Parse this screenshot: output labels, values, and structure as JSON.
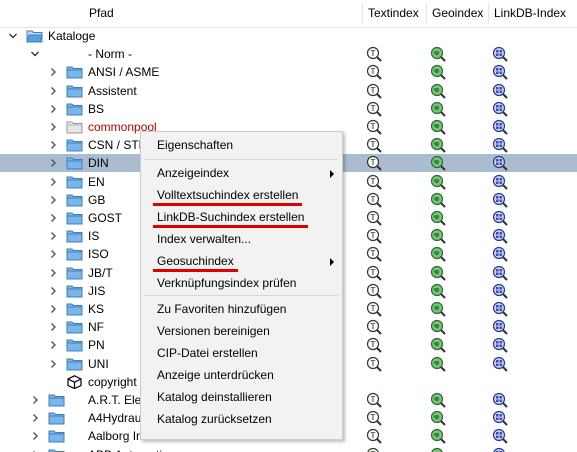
{
  "columns": {
    "path": "Pfad",
    "text": "Textindex",
    "geo": "Geoindex",
    "linkdb": "LinkDB-Index"
  },
  "tree": [
    {
      "label": "Kataloge",
      "kind": "root",
      "expander": "expanded",
      "icons": false
    },
    {
      "label": "- Norm -",
      "kind": "none",
      "expander": "expanded",
      "icons": true
    },
    {
      "label": "ANSI / ASME",
      "kind": "folder",
      "expander": "collapsed",
      "icons": true
    },
    {
      "label": "Assistent",
      "kind": "folder",
      "expander": "collapsed",
      "icons": true
    },
    {
      "label": "BS",
      "kind": "folder",
      "expander": "collapsed",
      "icons": true
    },
    {
      "label": "commonpool",
      "kind": "folder-gray",
      "expander": "collapsed",
      "icons": true,
      "red": true
    },
    {
      "label": "CSN / STN",
      "kind": "folder",
      "expander": "collapsed",
      "icons": true
    },
    {
      "label": "DIN",
      "kind": "folder",
      "expander": "collapsed",
      "icons": true,
      "selected": true
    },
    {
      "label": "EN",
      "kind": "folder",
      "expander": "collapsed",
      "icons": true
    },
    {
      "label": "GB",
      "kind": "folder",
      "expander": "collapsed",
      "icons": true
    },
    {
      "label": "GOST",
      "kind": "folder",
      "expander": "collapsed",
      "icons": true
    },
    {
      "label": "IS",
      "kind": "folder",
      "expander": "collapsed",
      "icons": true
    },
    {
      "label": "ISO",
      "kind": "folder",
      "expander": "collapsed",
      "icons": true
    },
    {
      "label": "JB/T",
      "kind": "folder",
      "expander": "collapsed",
      "icons": true
    },
    {
      "label": "JIS",
      "kind": "folder",
      "expander": "collapsed",
      "icons": true
    },
    {
      "label": "KS",
      "kind": "folder",
      "expander": "collapsed",
      "icons": true
    },
    {
      "label": "NF",
      "kind": "folder",
      "expander": "collapsed",
      "icons": true
    },
    {
      "label": "PN",
      "kind": "folder",
      "expander": "collapsed",
      "icons": true
    },
    {
      "label": "UNI",
      "kind": "folder",
      "expander": "collapsed",
      "icons": true
    },
    {
      "label": "copyright",
      "kind": "cube",
      "expander": "none",
      "icons": false
    },
    {
      "label": "A.R.T. Elek",
      "kind": "folder",
      "expander": "collapsed",
      "icons": true,
      "level": 1
    },
    {
      "label": "A4Hydrau",
      "kind": "folder",
      "expander": "collapsed",
      "icons": true,
      "level": 1
    },
    {
      "label": "Aalborg In",
      "kind": "folder",
      "expander": "collapsed",
      "icons": true,
      "level": 1
    },
    {
      "label": "ABB Automation",
      "kind": "folder",
      "expander": "collapsed",
      "icons": true,
      "level": 1
    }
  ],
  "context_menu": {
    "items": [
      {
        "label": "Eigenschaften"
      },
      {
        "sep": true
      },
      {
        "label": "Anzeigeindex",
        "submenu": true
      },
      {
        "label": "Volltextsuchindex erstellen",
        "underline": true
      },
      {
        "label": "LinkDB-Suchindex erstellen",
        "underline": true
      },
      {
        "label": "Index verwalten..."
      },
      {
        "label": "Geosuchindex",
        "submenu": true,
        "underline": true
      },
      {
        "label": "Verknüpfungsindex prüfen"
      },
      {
        "sep": true
      },
      {
        "label": "Zu Favoriten hinzufügen"
      },
      {
        "label": "Versionen bereinigen"
      },
      {
        "label": "CIP-Datei erstellen"
      },
      {
        "label": "Anzeige unterdrücken"
      },
      {
        "label": "Katalog deinstallieren"
      },
      {
        "label": "Katalog zurücksetzen"
      }
    ]
  },
  "colors": {
    "selection": "#a9bcd0",
    "underline": "#e00000",
    "red_text": "#c00000",
    "folder": "#5aa0dc",
    "text_index_icon": "#2e7d32",
    "geo_index_icon": "#2e8b3a",
    "linkdb_index_icon": "#3c4fb0"
  }
}
